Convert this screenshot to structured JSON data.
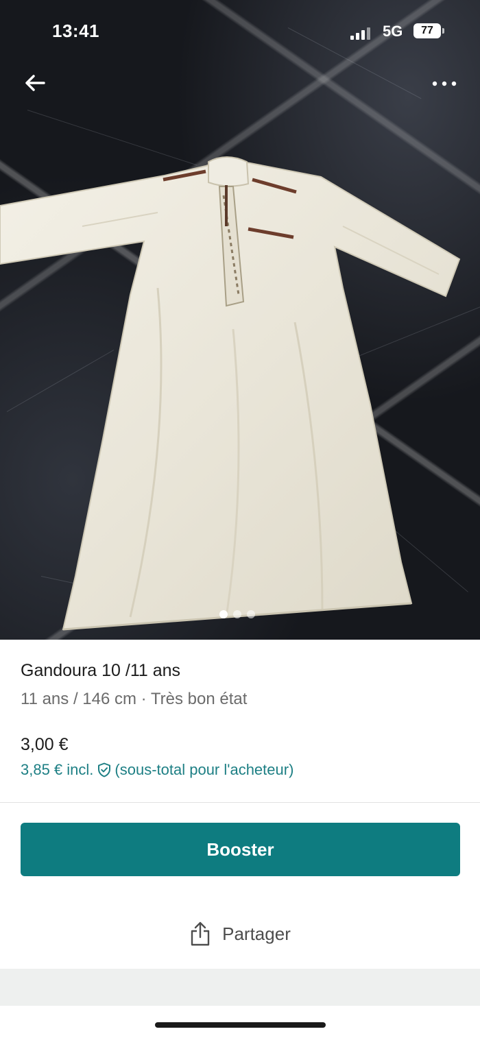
{
  "status_bar": {
    "time": "13:41",
    "network": "5G",
    "battery": "77"
  },
  "nav": {
    "back_icon": "arrow-left-icon",
    "more_icon": "more-horizontal-icon"
  },
  "carousel": {
    "count": 3,
    "active_index": 0
  },
  "item": {
    "title": "Gandoura 10 /11 ans",
    "subtitle": "11 ans / 146 cm · Très bon état",
    "price": "3,00 €",
    "price_incl": "3,85 € incl.",
    "buyer_note": "(sous-total pour l'acheteur)"
  },
  "actions": {
    "booster_label": "Booster",
    "share_label": "Partager",
    "share_icon": "share-icon"
  },
  "colors": {
    "accent": "#0e7c80",
    "accent_text": "#1d7f84"
  }
}
